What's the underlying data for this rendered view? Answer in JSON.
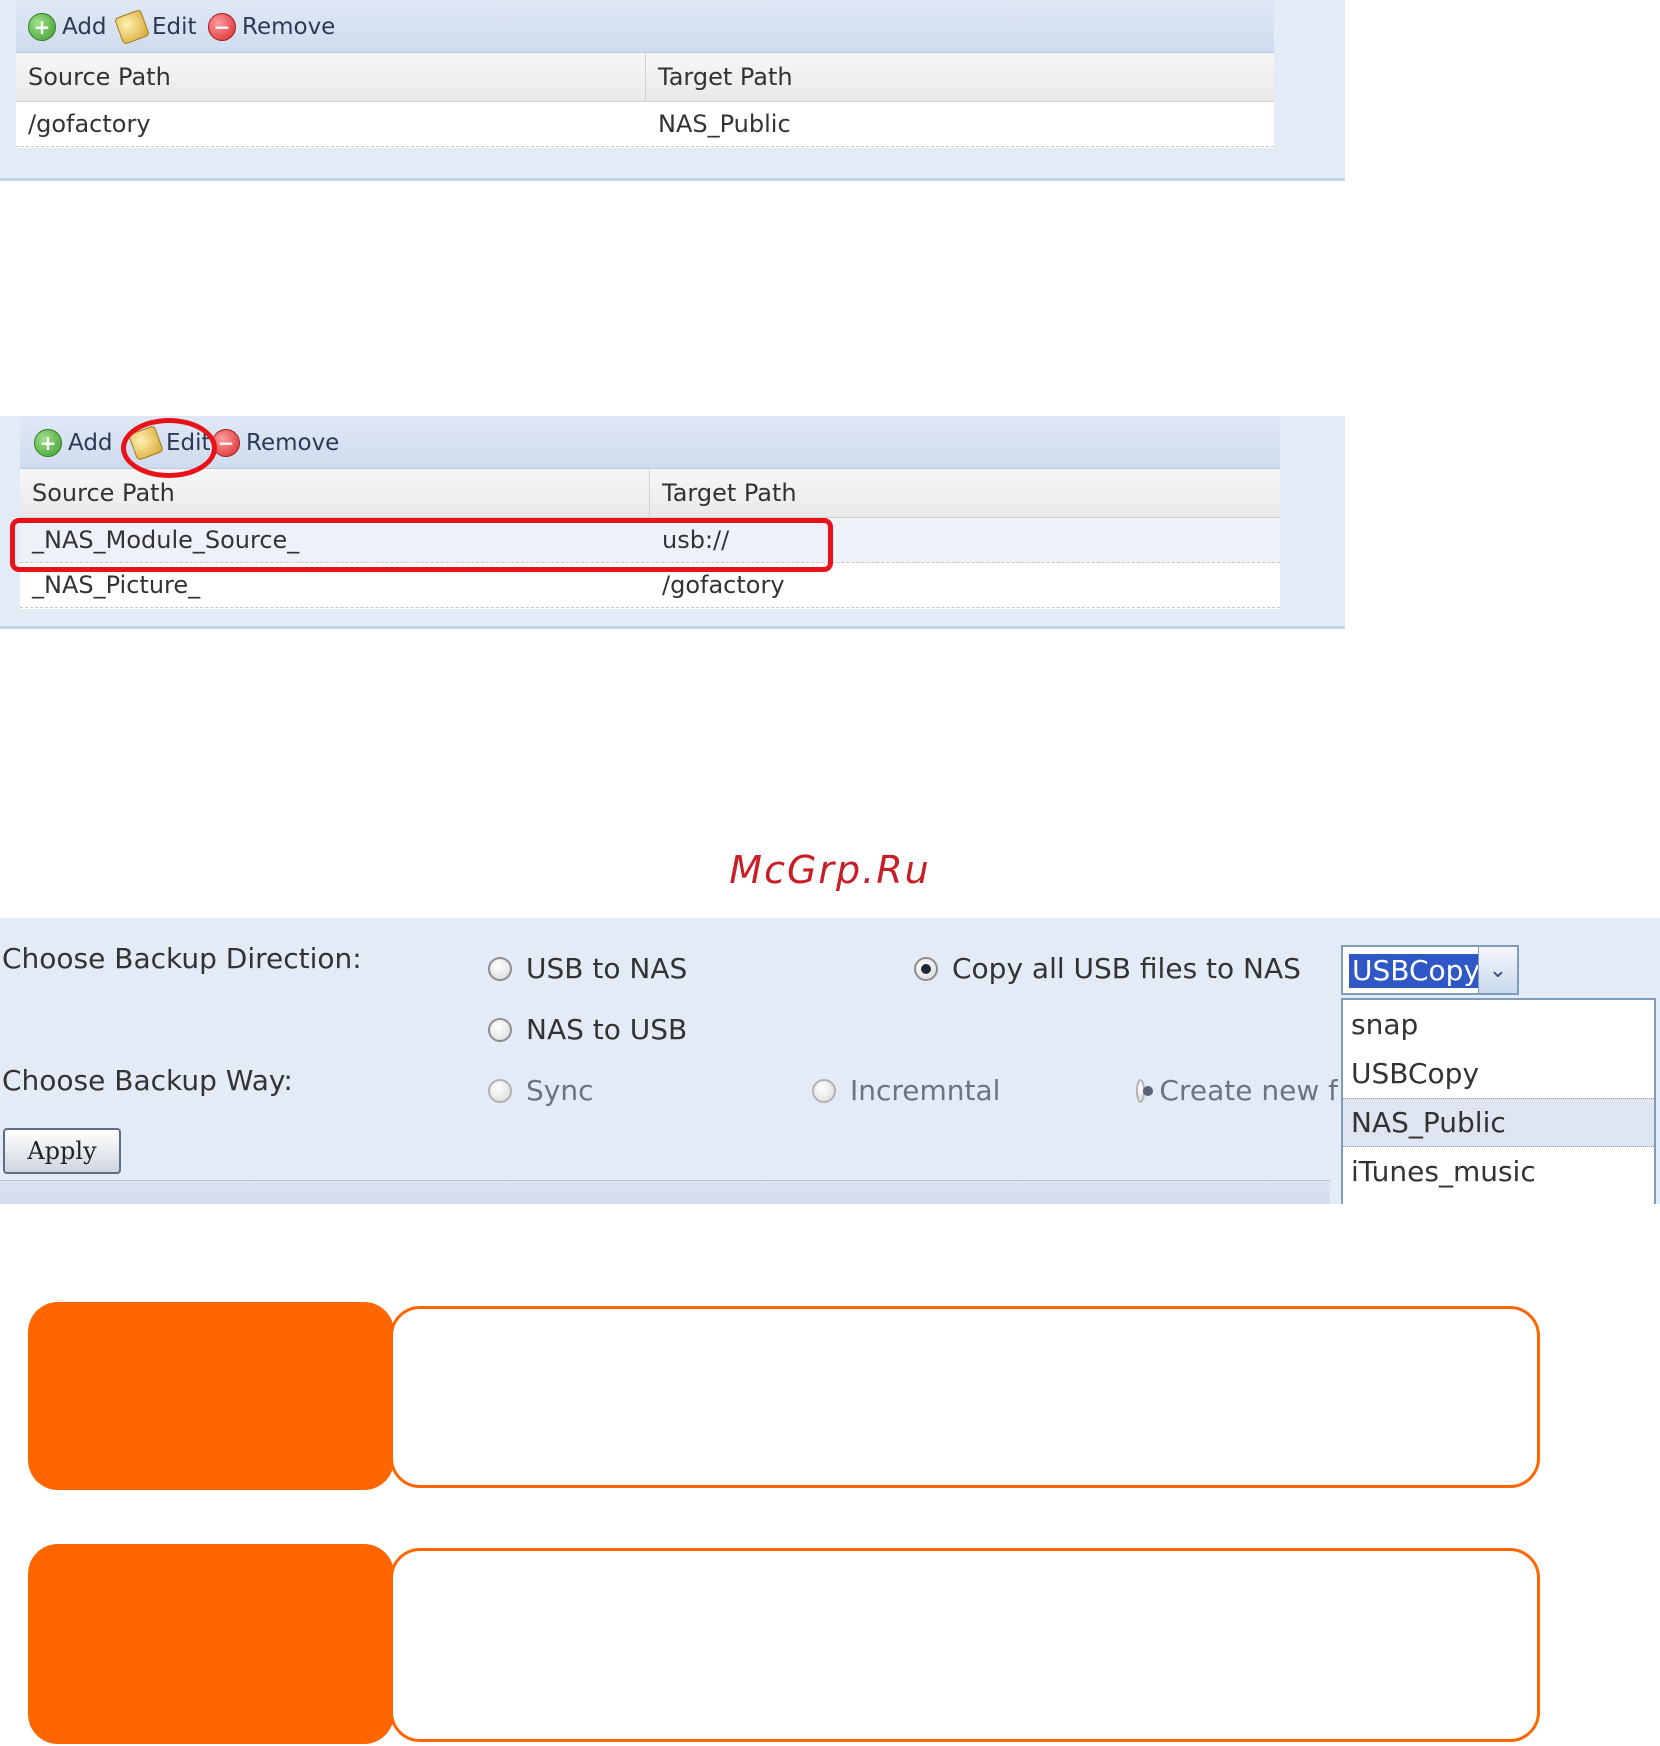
{
  "panel1": {
    "toolbar": {
      "add": "Add",
      "edit": "Edit",
      "remove": "Remove"
    },
    "columns": [
      "Source Path",
      "Target Path"
    ],
    "rows": [
      {
        "source": "/gofactory",
        "target": "NAS_Public"
      }
    ]
  },
  "panel2": {
    "toolbar": {
      "add": "Add",
      "edit": "Edit",
      "remove": "Remove"
    },
    "columns": [
      "Source Path",
      "Target Path"
    ],
    "rows": [
      {
        "source": "_NAS_Module_Source_",
        "target": "usb://"
      },
      {
        "source": "_NAS_Picture_",
        "target": "/gofactory"
      }
    ],
    "highlight_color": "#e8121b"
  },
  "watermark": "McGrp.Ru",
  "settings": {
    "direction_label": "Choose Backup Direction:",
    "direction_options": [
      "USB to NAS",
      "NAS to USB"
    ],
    "copy_all_option": "Copy all USB files to NAS",
    "target_select": {
      "value": "USBCopy",
      "options": [
        "snap",
        "USBCopy",
        "NAS_Public",
        "iTunes_music"
      ],
      "hovered": "NAS_Public"
    },
    "way_label": "Choose Backup Way:",
    "way_options": [
      "Sync",
      "Incremntal",
      "Create new f"
    ],
    "apply": "Apply"
  },
  "colors": {
    "panel_bg": "#e3ebf7",
    "accent_orange": "#ff6600"
  }
}
